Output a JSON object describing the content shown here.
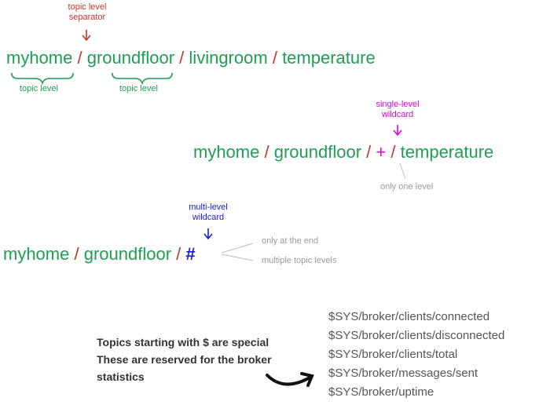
{
  "ex1": {
    "annot_top": [
      "topic level",
      "separator"
    ],
    "parts": [
      "myhome",
      "groundfloor",
      "livingroom",
      "temperature"
    ],
    "sep": "/",
    "brace_label": "topic level"
  },
  "ex2": {
    "annot_top": [
      "single-level",
      "wildcard"
    ],
    "parts": [
      "myhome",
      "groundfloor",
      "+",
      "temperature"
    ],
    "sep": "/",
    "note": "only one level"
  },
  "ex3": {
    "annot_top": [
      "multi-level",
      "wildcard"
    ],
    "parts": [
      "myhome",
      "groundfloor",
      "#"
    ],
    "sep": "/",
    "notes": [
      "only at the end",
      "multiple topic levels"
    ]
  },
  "sys_note": {
    "lines": [
      "Topics starting with $ are special",
      "These are reserved for the broker",
      "statistics"
    ]
  },
  "sys_topics": [
    "$SYS/broker/clients/connected",
    "$SYS/broker/clients/disconnected",
    "$SYS/broker/clients/total",
    "$SYS/broker/messages/sent",
    "$SYS/broker/uptime"
  ],
  "colors": {
    "green": "#1e9e52",
    "red": "#c0392b",
    "magenta": "#e600e6",
    "blue": "#1a1adb",
    "grey": "#9a9a9a"
  }
}
